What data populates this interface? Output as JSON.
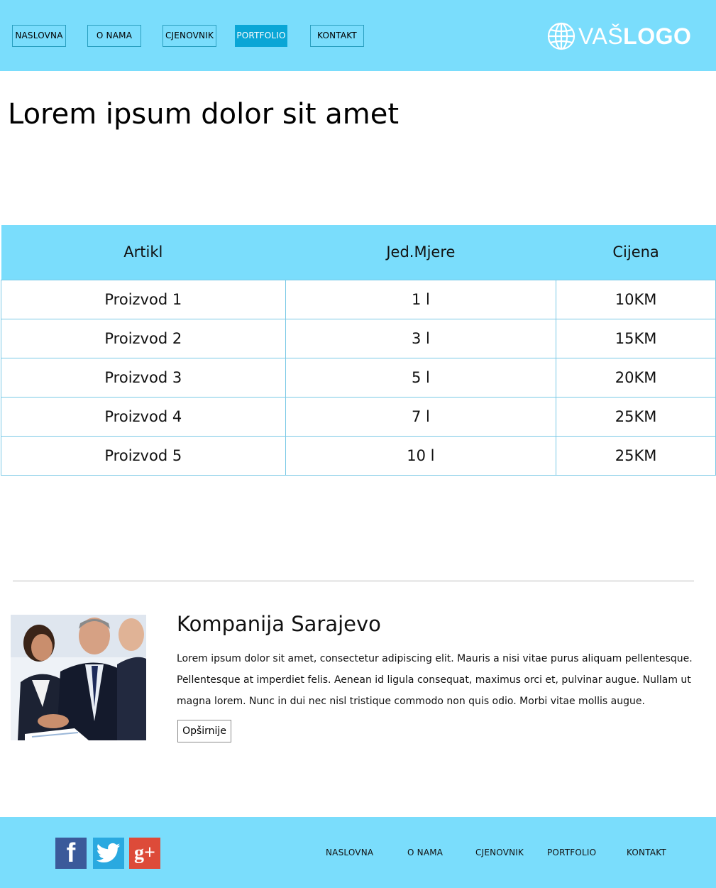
{
  "header": {
    "nav": [
      {
        "label": "NASLOVNA",
        "active": false
      },
      {
        "label": "O NAMA",
        "active": false
      },
      {
        "label": "CJENOVNIK",
        "active": false
      },
      {
        "label": "PORTFOLIO",
        "active": true
      },
      {
        "label": "KONTAKT",
        "active": false
      }
    ],
    "logo": {
      "first": "VAŠ",
      "second": "LOGO",
      "icon": "globe-icon"
    }
  },
  "main": {
    "title": "Lorem ipsum dolor sit amet",
    "table": {
      "headers": [
        "Artikl",
        "Jed.Mjere",
        "Cijena"
      ],
      "rows": [
        [
          "Proizvod 1",
          "1 l",
          "10KM"
        ],
        [
          "Proizvod 2",
          "3 l",
          "15KM"
        ],
        [
          "Proizvod 3",
          "5 l",
          "20KM"
        ],
        [
          "Proizvod 4",
          "7 l",
          "25KM"
        ],
        [
          "Proizvod 5",
          "10 l",
          "25KM"
        ]
      ]
    }
  },
  "company": {
    "title": "Kompanija Sarajevo",
    "text": "Lorem ipsum dolor sit amet, consectetur adipiscing elit. Mauris a nisi vitae purus aliquam pellentesque. Pellentesque at imperdiet felis. Aenean id ligula consequat, maximus orci et, pulvinar augue. Nullam ut magna lorem. Nunc in dui nec nisl tristique commodo non quis odio. Morbi vitae mollis augue.",
    "button": "Opširnije"
  },
  "footer": {
    "social": [
      "facebook-icon",
      "twitter-icon",
      "google-plus-icon"
    ],
    "facebook_glyph": "f",
    "gplus_glyph": "g+",
    "links": [
      "NASLOVNA",
      "O NAMA",
      "CJENOVNIK",
      "PORTFOLIO",
      "KONTAKT"
    ]
  },
  "colors": {
    "primary": "#7addfc",
    "active": "#0aa6d6"
  }
}
